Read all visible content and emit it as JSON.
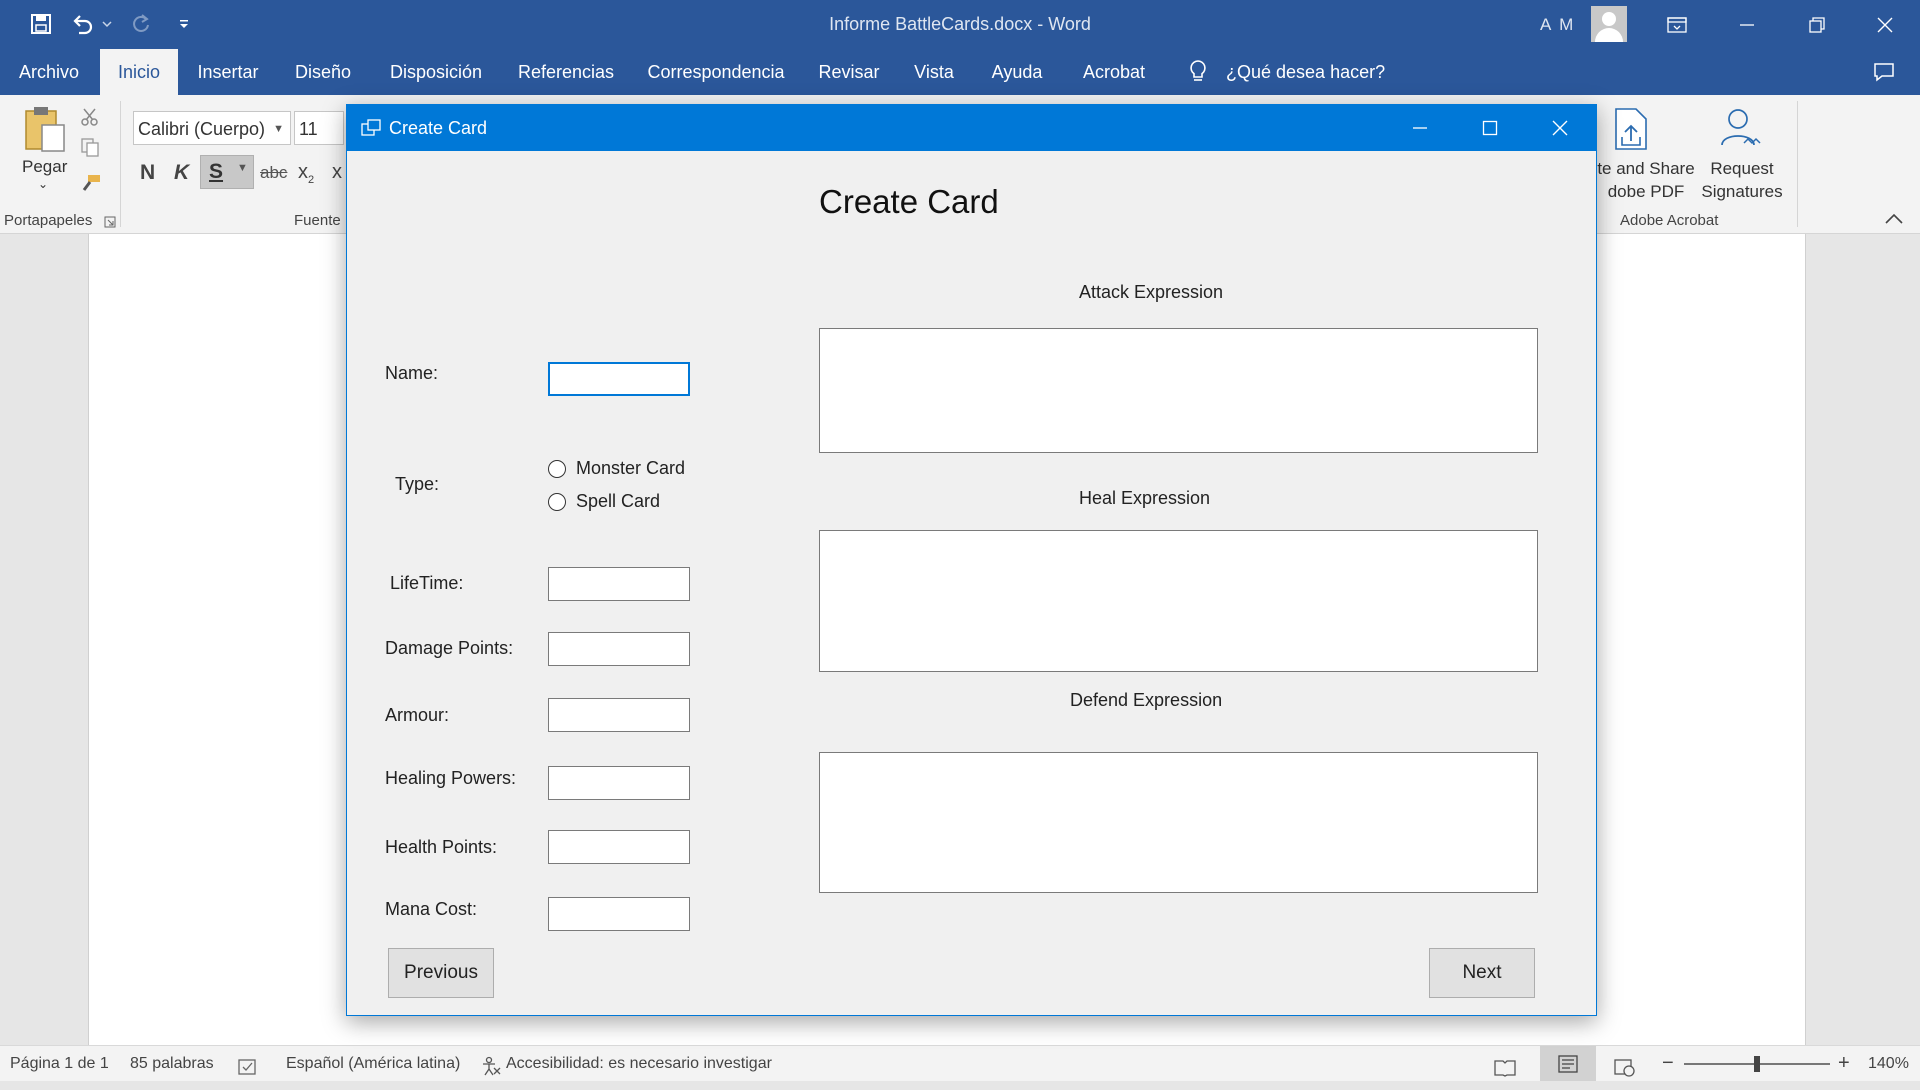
{
  "app": {
    "document_title": "Informe  BattleCards.docx  -  Word",
    "user_initials": "A M"
  },
  "tabs": [
    {
      "label": "Archivo"
    },
    {
      "label": "Inicio"
    },
    {
      "label": "Insertar"
    },
    {
      "label": "Diseño"
    },
    {
      "label": "Disposición"
    },
    {
      "label": "Referencias"
    },
    {
      "label": "Correspondencia"
    },
    {
      "label": "Revisar"
    },
    {
      "label": "Vista"
    },
    {
      "label": "Ayuda"
    },
    {
      "label": "Acrobat"
    }
  ],
  "tell_me": "¿Qué desea hacer?",
  "ribbon": {
    "paste_label": "Pegar",
    "clipboard_group": "Portapapeles",
    "font_group": "Fuente",
    "font_name": "Calibri (Cuerpo)",
    "font_size": "11",
    "bold": "N",
    "italic": "K",
    "underline": "S",
    "strike": "abc",
    "subscript": "x",
    "superscript": "x",
    "share_pdf_line1": "te and Share",
    "share_pdf_line2": "dobe PDF",
    "request_sign_line1": "Request",
    "request_sign_line2": "Signatures",
    "acrobat_group": "Adobe Acrobat"
  },
  "status": {
    "page": "Página 1 de 1",
    "words": "85 palabras",
    "language": "Español (América latina)",
    "accessibility": "Accesibilidad: es necesario investigar",
    "zoom": "140%",
    "zoom_level_fraction": 0.5
  },
  "dialog": {
    "title": "Create Card",
    "heading": "Create Card",
    "name_label": "Name:",
    "type_label": "Type:",
    "radio_monster": "Monster Card",
    "radio_spell": "Spell Card",
    "lifetime_label": "LifeTime:",
    "damage_label": "Damage Points:",
    "armour_label": "Armour:",
    "healing_label": "Healing Powers:",
    "health_label": "Health Points:",
    "mana_label": "Mana Cost:",
    "attack_label": "Attack Expression",
    "heal_label": "Heal Expression",
    "defend_label": "Defend Expression",
    "previous": "Previous",
    "next": "Next"
  }
}
